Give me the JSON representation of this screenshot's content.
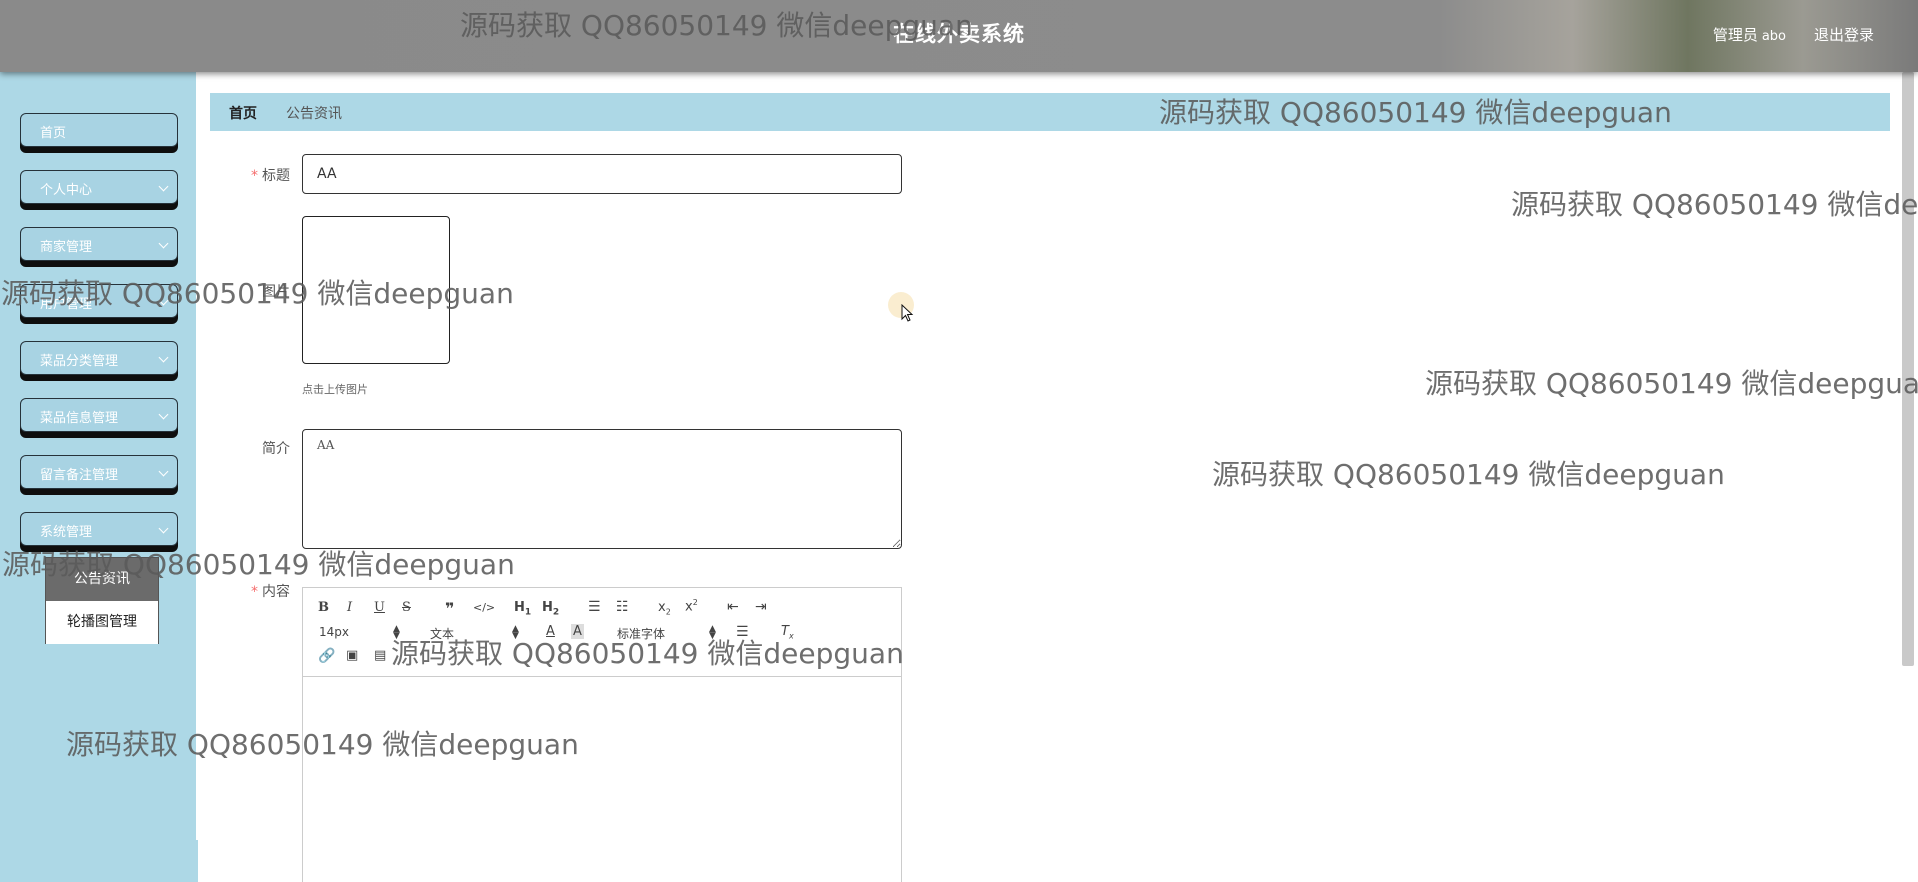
{
  "header": {
    "title": "在线外卖系统",
    "user_role": "管理员",
    "user_name": "abo",
    "logout_label": "退出登录"
  },
  "sidebar": {
    "items": [
      {
        "label": "首页",
        "has_arrow": false
      },
      {
        "label": "个人中心",
        "has_arrow": true
      },
      {
        "label": "商家管理",
        "has_arrow": true
      },
      {
        "label": "用户管理",
        "has_arrow": true
      },
      {
        "label": "菜品分类管理",
        "has_arrow": true
      },
      {
        "label": "菜品信息管理",
        "has_arrow": true
      },
      {
        "label": "留言备注管理",
        "has_arrow": true
      },
      {
        "label": "系统管理",
        "has_arrow": true
      }
    ],
    "submenu": [
      {
        "label": "公告资讯",
        "active": true
      },
      {
        "label": "轮播图管理",
        "active": false
      }
    ]
  },
  "breadcrumb": {
    "home": "首页",
    "current": "公告资讯"
  },
  "form": {
    "title_label": "标题",
    "title_value": "AA",
    "image_label": "图片",
    "upload_tip": "点击上传图片",
    "intro_label": "简介",
    "intro_value": "AA",
    "content_label": "内容"
  },
  "editor": {
    "font_size": "14px",
    "header_select": "文本",
    "font_family": "标准字体"
  },
  "watermark_text": "源码获取 QQ86050149 微信deepguan",
  "colors": {
    "sidebar_bg": "#add8e6",
    "header_bg": "#8a8a8a",
    "required_mark": "#f56c6c",
    "active_submenu_bg": "#6b6b6b"
  }
}
